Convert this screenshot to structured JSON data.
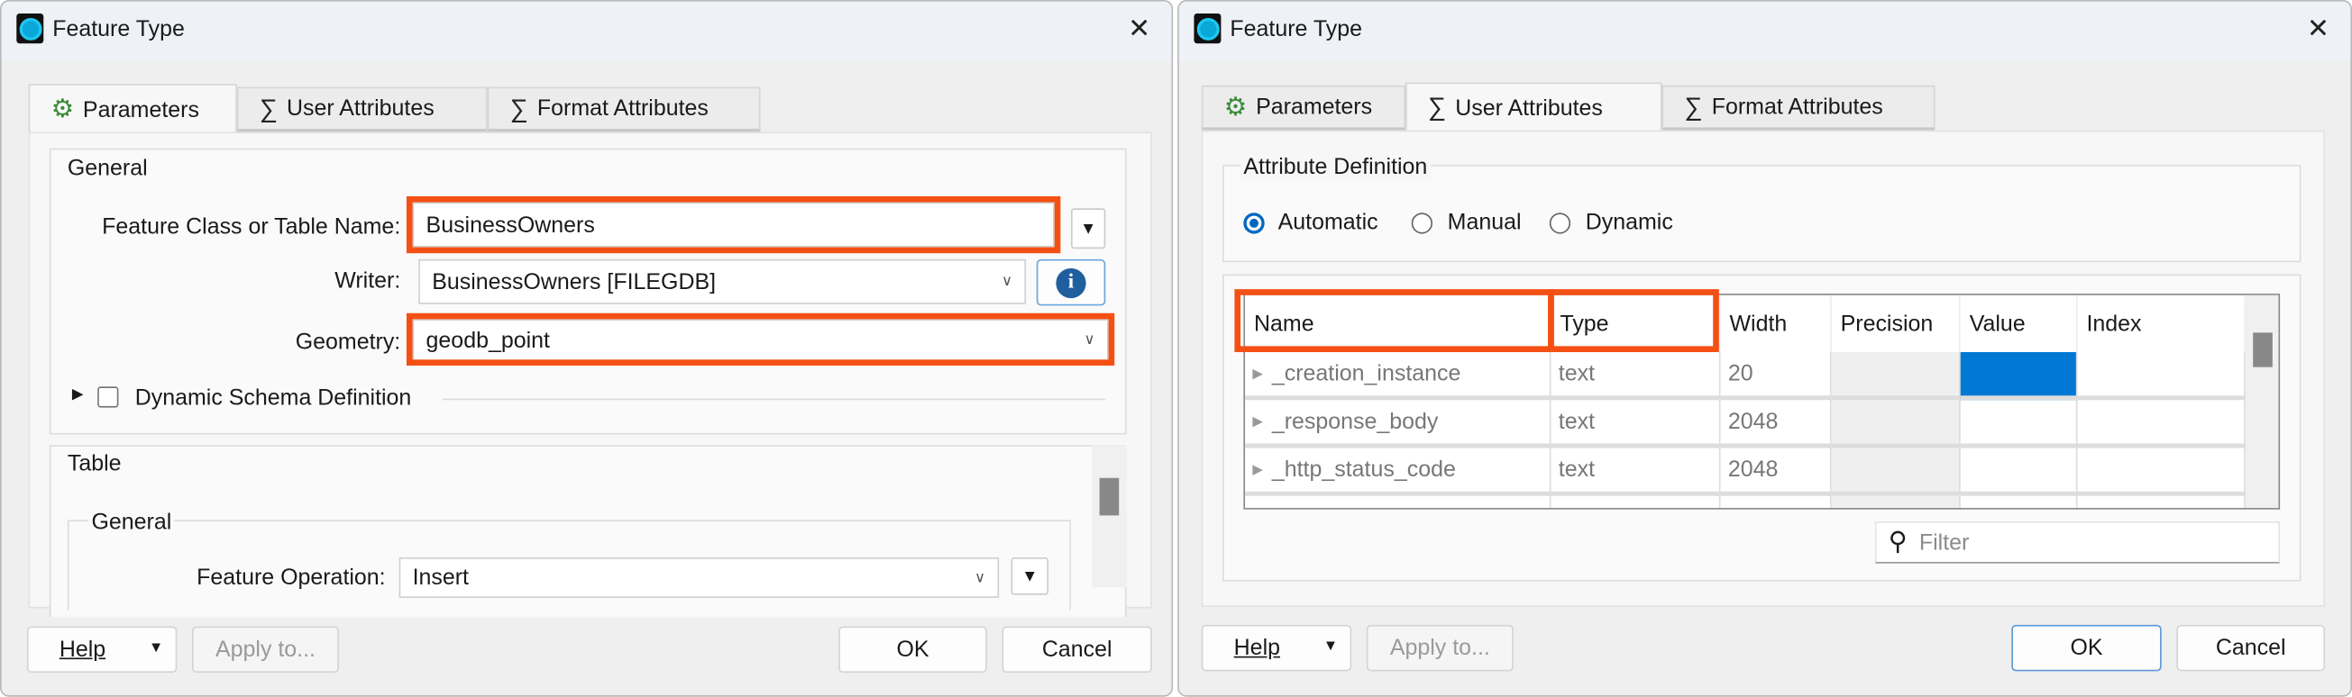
{
  "colors": {
    "highlight": "#f55014",
    "selected_cell": "#0078d4",
    "accent": "#0067c0"
  },
  "left": {
    "title": "Feature Type",
    "tabs": [
      {
        "label": "Parameters",
        "icon": "gear-icon",
        "active": true
      },
      {
        "label": "User Attributes",
        "icon": "sigma-icon"
      },
      {
        "label": "Format Attributes",
        "icon": "sigma-icon"
      }
    ],
    "general": {
      "label": "General",
      "feature_class_label": "Feature Class or Table Name:",
      "feature_class_value": "BusinessOwners",
      "writer_label": "Writer:",
      "writer_value": "BusinessOwners [FILEGDB]",
      "geometry_label": "Geometry:",
      "geometry_value": "geodb_point",
      "dynamic_schema_label": "Dynamic Schema Definition",
      "dynamic_schema_checked": false
    },
    "table": {
      "label": "Table",
      "general_label": "General",
      "feature_operation_label": "Feature Operation:",
      "feature_operation_value": "Insert"
    },
    "buttons": {
      "help": "Help",
      "apply": "Apply to...",
      "ok": "OK",
      "cancel": "Cancel"
    }
  },
  "right": {
    "title": "Feature Type",
    "tabs": [
      {
        "label": "Parameters",
        "icon": "gear-icon"
      },
      {
        "label": "User Attributes",
        "icon": "sigma-icon",
        "active": true
      },
      {
        "label": "Format Attributes",
        "icon": "sigma-icon"
      }
    ],
    "attr_def": {
      "label": "Attribute Definition",
      "options": [
        "Automatic",
        "Manual",
        "Dynamic"
      ],
      "selected": "Automatic"
    },
    "grid": {
      "columns": [
        "Name",
        "Type",
        "Width",
        "Precision",
        "Value",
        "Index"
      ],
      "rows": [
        {
          "name": "_creation_instance",
          "type": "text",
          "width": "20",
          "precision": "",
          "value": "",
          "index": ""
        },
        {
          "name": "_response_body",
          "type": "text",
          "width": "2048",
          "precision": "",
          "value": "",
          "index": ""
        },
        {
          "name": "_http_status_code",
          "type": "text",
          "width": "2048",
          "precision": "",
          "value": "",
          "index": ""
        }
      ]
    },
    "filter_placeholder": "Filter",
    "buttons": {
      "help": "Help",
      "apply": "Apply to...",
      "ok": "OK",
      "cancel": "Cancel"
    }
  }
}
